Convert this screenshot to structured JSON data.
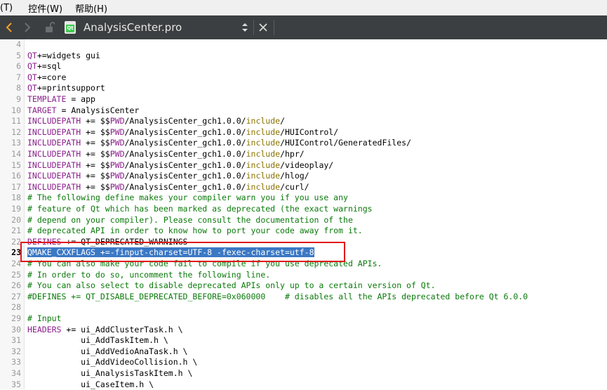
{
  "menubar": {
    "items": [
      {
        "label": "(T)"
      },
      {
        "label": "控件(W)"
      },
      {
        "label": "帮助(H)"
      }
    ]
  },
  "toolbar": {
    "file_name": "AnalysisCenter.pro",
    "file_icon_label": "Qt",
    "icons": [
      "back-arrow-icon",
      "forward-arrow-icon",
      "lock-icon",
      "qt-file-icon",
      "updown-arrow-icon",
      "close-icon"
    ]
  },
  "editor": {
    "lines": [
      {
        "n": "4",
        "t": [
          {
            "s": "",
            "c": ""
          }
        ]
      },
      {
        "n": "5",
        "t": [
          {
            "s": "QT",
            "c": "kw"
          },
          {
            "s": "+=widgets gui",
            "c": ""
          }
        ]
      },
      {
        "n": "6",
        "t": [
          {
            "s": "QT",
            "c": "kw"
          },
          {
            "s": "+=sql",
            "c": ""
          }
        ]
      },
      {
        "n": "7",
        "t": [
          {
            "s": "QT",
            "c": "kw"
          },
          {
            "s": "+=core",
            "c": ""
          }
        ]
      },
      {
        "n": "8",
        "t": [
          {
            "s": "QT",
            "c": "kw"
          },
          {
            "s": "+=printsupport",
            "c": ""
          }
        ]
      },
      {
        "n": "9",
        "t": [
          {
            "s": "TEMPLATE",
            "c": "kw"
          },
          {
            "s": " = app",
            "c": ""
          }
        ]
      },
      {
        "n": "10",
        "t": [
          {
            "s": "TARGET",
            "c": "kw"
          },
          {
            "s": " = AnalysisCenter",
            "c": ""
          }
        ]
      },
      {
        "n": "11",
        "t": [
          {
            "s": "INCLUDEPATH",
            "c": "kw"
          },
          {
            "s": " += $$",
            "c": ""
          },
          {
            "s": "PWD",
            "c": "kw"
          },
          {
            "s": "/AnalysisCenter_gch1.0.0/",
            "c": ""
          },
          {
            "s": "include",
            "c": "inc"
          },
          {
            "s": "/",
            "c": ""
          }
        ]
      },
      {
        "n": "12",
        "t": [
          {
            "s": "INCLUDEPATH",
            "c": "kw"
          },
          {
            "s": " += $$",
            "c": ""
          },
          {
            "s": "PWD",
            "c": "kw"
          },
          {
            "s": "/AnalysisCenter_gch1.0.0/",
            "c": ""
          },
          {
            "s": "include",
            "c": "inc"
          },
          {
            "s": "/HUIControl/",
            "c": ""
          }
        ]
      },
      {
        "n": "13",
        "t": [
          {
            "s": "INCLUDEPATH",
            "c": "kw"
          },
          {
            "s": " += $$",
            "c": ""
          },
          {
            "s": "PWD",
            "c": "kw"
          },
          {
            "s": "/AnalysisCenter_gch1.0.0/",
            "c": ""
          },
          {
            "s": "include",
            "c": "inc"
          },
          {
            "s": "/HUIControl/GeneratedFiles/",
            "c": ""
          }
        ]
      },
      {
        "n": "14",
        "t": [
          {
            "s": "INCLUDEPATH",
            "c": "kw"
          },
          {
            "s": " += $$",
            "c": ""
          },
          {
            "s": "PWD",
            "c": "kw"
          },
          {
            "s": "/AnalysisCenter_gch1.0.0/",
            "c": ""
          },
          {
            "s": "include",
            "c": "inc"
          },
          {
            "s": "/hpr/",
            "c": ""
          }
        ]
      },
      {
        "n": "15",
        "t": [
          {
            "s": "INCLUDEPATH",
            "c": "kw"
          },
          {
            "s": " += $$",
            "c": ""
          },
          {
            "s": "PWD",
            "c": "kw"
          },
          {
            "s": "/AnalysisCenter_gch1.0.0/",
            "c": ""
          },
          {
            "s": "include",
            "c": "inc"
          },
          {
            "s": "/videoplay/",
            "c": ""
          }
        ]
      },
      {
        "n": "16",
        "t": [
          {
            "s": "INCLUDEPATH",
            "c": "kw"
          },
          {
            "s": " += $$",
            "c": ""
          },
          {
            "s": "PWD",
            "c": "kw"
          },
          {
            "s": "/AnalysisCenter_gch1.0.0/",
            "c": ""
          },
          {
            "s": "include",
            "c": "inc"
          },
          {
            "s": "/hlog/",
            "c": ""
          }
        ]
      },
      {
        "n": "17",
        "t": [
          {
            "s": "INCLUDEPATH",
            "c": "kw"
          },
          {
            "s": " += $$",
            "c": ""
          },
          {
            "s": "PWD",
            "c": "kw"
          },
          {
            "s": "/AnalysisCenter_gch1.0.0/",
            "c": ""
          },
          {
            "s": "include",
            "c": "inc"
          },
          {
            "s": "/curl/",
            "c": ""
          }
        ]
      },
      {
        "n": "18",
        "t": [
          {
            "s": "# The following define makes your compiler warn you if you use any",
            "c": "cm"
          }
        ]
      },
      {
        "n": "19",
        "t": [
          {
            "s": "# feature of Qt which has been marked as deprecated (the exact warnings",
            "c": "cm"
          }
        ]
      },
      {
        "n": "20",
        "t": [
          {
            "s": "# depend on your compiler). Please consult the documentation of the",
            "c": "cm"
          }
        ]
      },
      {
        "n": "21",
        "t": [
          {
            "s": "# deprecated API in order to know how to port your code away from it.",
            "c": "cm"
          }
        ]
      },
      {
        "n": "22",
        "t": [
          {
            "s": "DEFINES",
            "c": "kw"
          },
          {
            "s": " += QT_DEPRECATED_WARNINGS",
            "c": ""
          }
        ]
      },
      {
        "n": "23",
        "current": true,
        "t": [
          {
            "s": "QMAKE_CXXFLAGS +=-finput-charset=UTF-8 -fexec-charset=utf-8",
            "c": "sel"
          }
        ]
      },
      {
        "n": "24",
        "t": [
          {
            "s": "# You can also make your code fail to compile if you use deprecated APIs.",
            "c": "cm"
          }
        ]
      },
      {
        "n": "25",
        "t": [
          {
            "s": "# In order to do so, uncomment the following line.",
            "c": "cm"
          }
        ]
      },
      {
        "n": "26",
        "t": [
          {
            "s": "# You can also select to disable deprecated APIs only up to a certain version of Qt.",
            "c": "cm"
          }
        ]
      },
      {
        "n": "27",
        "t": [
          {
            "s": "#DEFINES += QT_DISABLE_DEPRECATED_BEFORE=0x060000    # disables all the APIs deprecated before Qt 6.0.0",
            "c": "cm"
          }
        ]
      },
      {
        "n": "28",
        "t": [
          {
            "s": "",
            "c": ""
          }
        ]
      },
      {
        "n": "29",
        "t": [
          {
            "s": "# Input",
            "c": "cm"
          }
        ]
      },
      {
        "n": "30",
        "t": [
          {
            "s": "HEADERS",
            "c": "kw"
          },
          {
            "s": " += ui_AddClusterTask.h \\",
            "c": ""
          }
        ]
      },
      {
        "n": "31",
        "t": [
          {
            "s": "           ui_AddTaskItem.h \\",
            "c": ""
          }
        ]
      },
      {
        "n": "32",
        "t": [
          {
            "s": "           ui_AddVedioAnaTask.h \\",
            "c": ""
          }
        ]
      },
      {
        "n": "33",
        "t": [
          {
            "s": "           ui_AddVideoCollision.h \\",
            "c": ""
          }
        ]
      },
      {
        "n": "34",
        "t": [
          {
            "s": "           ui_AnalysisTaskItem.h \\",
            "c": ""
          }
        ]
      },
      {
        "n": "35",
        "t": [
          {
            "s": "           ui_CaseItem.h \\",
            "c": ""
          }
        ]
      }
    ]
  }
}
